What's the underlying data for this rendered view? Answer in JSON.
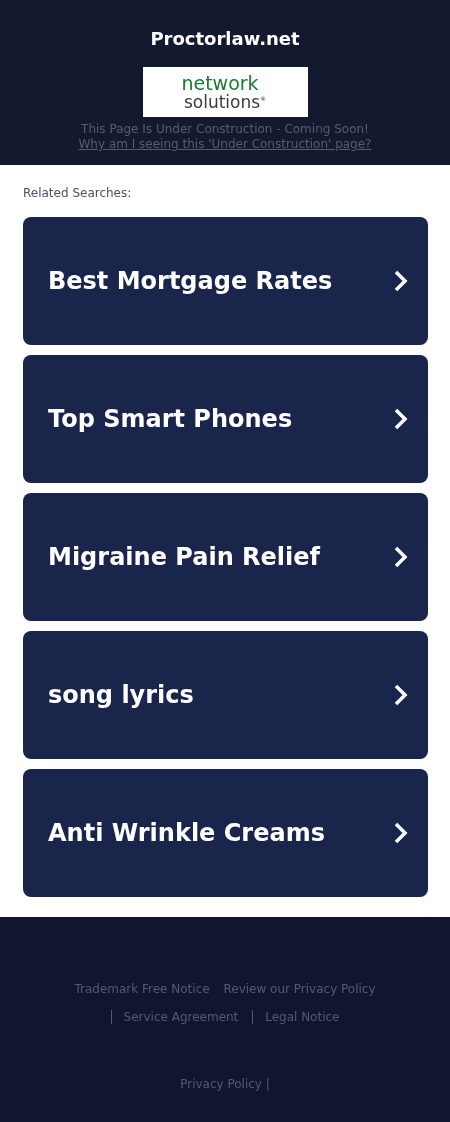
{
  "header": {
    "title": "Proctorlaw.net",
    "logo": {
      "line1": "network",
      "line2": "solutions$^{®}$"
    },
    "notice": "This Page Is Under Construction - Coming Soon!",
    "why_link": "Why am I seeing this 'Under Construction' page?"
  },
  "related": {
    "heading": "Related Searches:",
    "items": [
      {
        "label": "Best Mortgage Rates"
      },
      {
        "label": "Top Smart Phones"
      },
      {
        "label": "Migraine Pain Relief"
      },
      {
        "label": "song lyrics"
      },
      {
        "label": "Anti Wrinkle Creams"
      }
    ]
  },
  "footer": {
    "links": [
      {
        "label": "Trademark Free Notice",
        "divider": false
      },
      {
        "label": "Review our Privacy Policy",
        "divider": false
      },
      {
        "label": "Service Agreement",
        "divider": true
      },
      {
        "label": "Legal Notice",
        "divider": true
      }
    ],
    "privacy": {
      "label": "Privacy Policy",
      "separator": "|"
    }
  }
}
